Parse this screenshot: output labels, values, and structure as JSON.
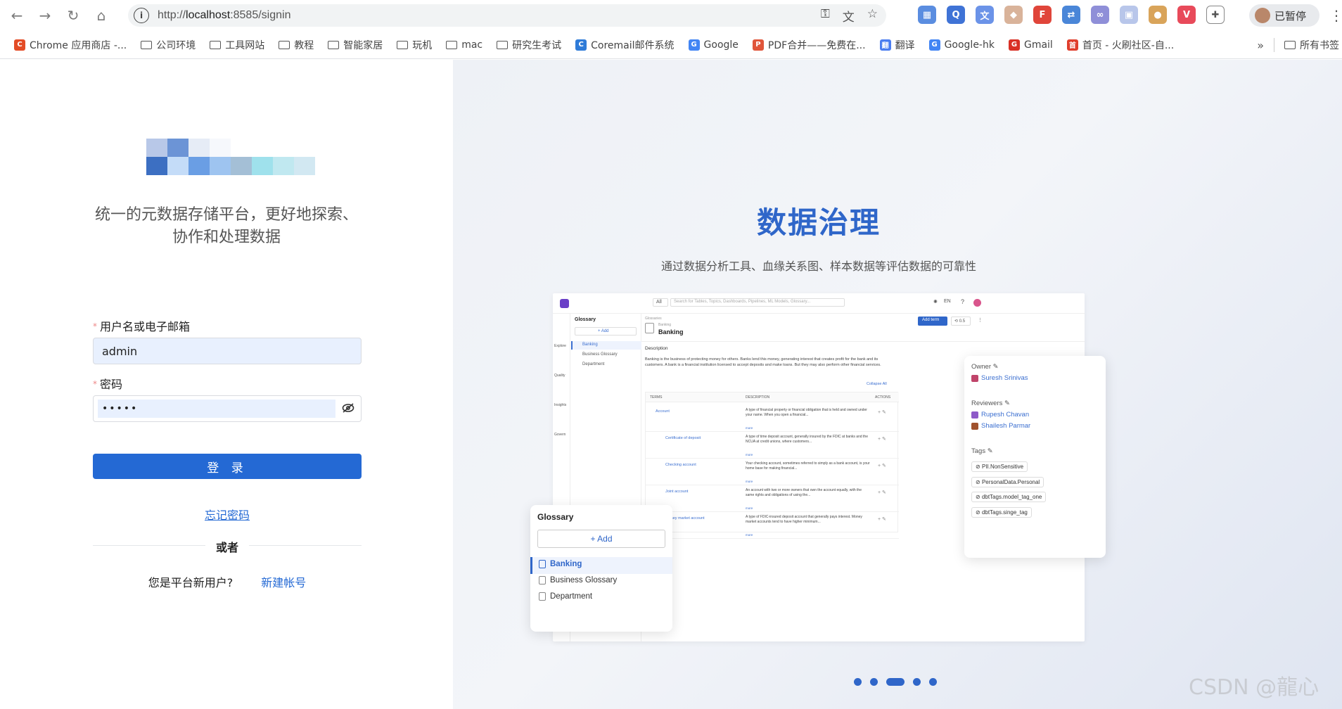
{
  "browser": {
    "url_scheme": "http://",
    "url_host": "localhost",
    "url_rest": ":8585/signin",
    "profile_status": "已暂停",
    "bookmarks": [
      {
        "label": "Chrome 应用商店 -...",
        "kind": "favicon",
        "color": "#e34c26"
      },
      {
        "label": "公司环境",
        "kind": "folder"
      },
      {
        "label": "工具网站",
        "kind": "folder"
      },
      {
        "label": "教程",
        "kind": "folder"
      },
      {
        "label": "智能家居",
        "kind": "folder"
      },
      {
        "label": "玩机",
        "kind": "folder"
      },
      {
        "label": "mac",
        "kind": "folder"
      },
      {
        "label": "研究生考试",
        "kind": "folder"
      },
      {
        "label": "Coremail邮件系统",
        "kind": "favicon",
        "color": "#2f7bd8"
      },
      {
        "label": "Google",
        "kind": "favicon",
        "color": "#4285f4"
      },
      {
        "label": "PDF合并——免费在...",
        "kind": "favicon",
        "color": "#e0553a"
      },
      {
        "label": "翻译",
        "kind": "favicon",
        "color": "#4a7df0"
      },
      {
        "label": "Google-hk",
        "kind": "favicon",
        "color": "#4285f4"
      },
      {
        "label": "Gmail",
        "kind": "favicon",
        "color": "#d93025"
      },
      {
        "label": "首页 - 火刷社区-自...",
        "kind": "favicon",
        "color": "#e03e2d"
      }
    ],
    "bookmarks_more": "»",
    "all_bookmarks": "所有书签"
  },
  "signin": {
    "tagline": "统一的元数据存储平台，更好地探索、协作和处理数据",
    "username_label": "用户名或电子邮箱",
    "username_value": "admin",
    "password_label": "密码",
    "password_value": "•••••",
    "login_button": "登 录",
    "forgot_link": "忘记密码",
    "or_text": "或者",
    "new_user_text": "您是平台新用户?",
    "signup_link": "新建帐号"
  },
  "carousel": {
    "title": "数据治理",
    "subtitle": "通过数据分析工具、血缘关系图、样本数据等评估数据的可靠性",
    "slide_count": 5,
    "active_slide": 3
  },
  "preview": {
    "search_scope": "All",
    "search_placeholder": "Search for Tables, Topics, Dashboards, Pipelines, ML Models, Glossary...",
    "lang": "EN",
    "nav": [
      "Explore",
      "Quality",
      "Insights",
      "Govern"
    ],
    "breadcrumb": "Glossaries",
    "crumb_sub": "Banking",
    "page_title": "Banking",
    "add_term": "Add term",
    "version": "0.5",
    "description_label": "Description",
    "description": "Banking is the business of protecting money for others. Banks lend this money, generating interest that creates profit for the bank and its customers. A bank is a financial institution licensed to accept deposits and make loans. But they may also perform other financial services.",
    "collapse_all": "Collapse All",
    "col_terms": "TERMS",
    "col_description": "DESCRIPTION",
    "col_actions": "ACTIONS",
    "more": "more",
    "terms": [
      {
        "name": "Account",
        "desc": "A type of financial property or financial obligation that is held and owned under your name. When you open a financial..."
      },
      {
        "name": "Certificate of deposit",
        "desc": "A type of time deposit account, generally insured by the FDIC at banks and the NCUA at credit unions, where customers..."
      },
      {
        "name": "Checking account",
        "desc": "Your checking account, sometimes referred to simply as a bank account, is your home base for making financial..."
      },
      {
        "name": "Joint account",
        "desc": "An account with two or more owners that own the account equally, with the same rights and obligations of using the..."
      },
      {
        "name": "Money market account",
        "desc": "A type of FDIC-insured deposit account that generally pays interest. Money market accounts tend to have higher minimum..."
      }
    ],
    "glossary_panel": {
      "title": "Glossary",
      "add": "+ Add",
      "items": [
        "Banking",
        "Business Glossary",
        "Department"
      ]
    },
    "info_panel": {
      "owner_label": "Owner",
      "owner": "Suresh Srinivas",
      "reviewers_label": "Reviewers",
      "reviewers": [
        "Rupesh Chavan",
        "Shailesh Parmar"
      ],
      "tags_label": "Tags",
      "tags": [
        "PII.NonSensitive",
        "PersonalData.Personal",
        "dbtTags.model_tag_one",
        "dbtTags.singe_tag"
      ]
    }
  },
  "watermark": "CSDN @龍心"
}
